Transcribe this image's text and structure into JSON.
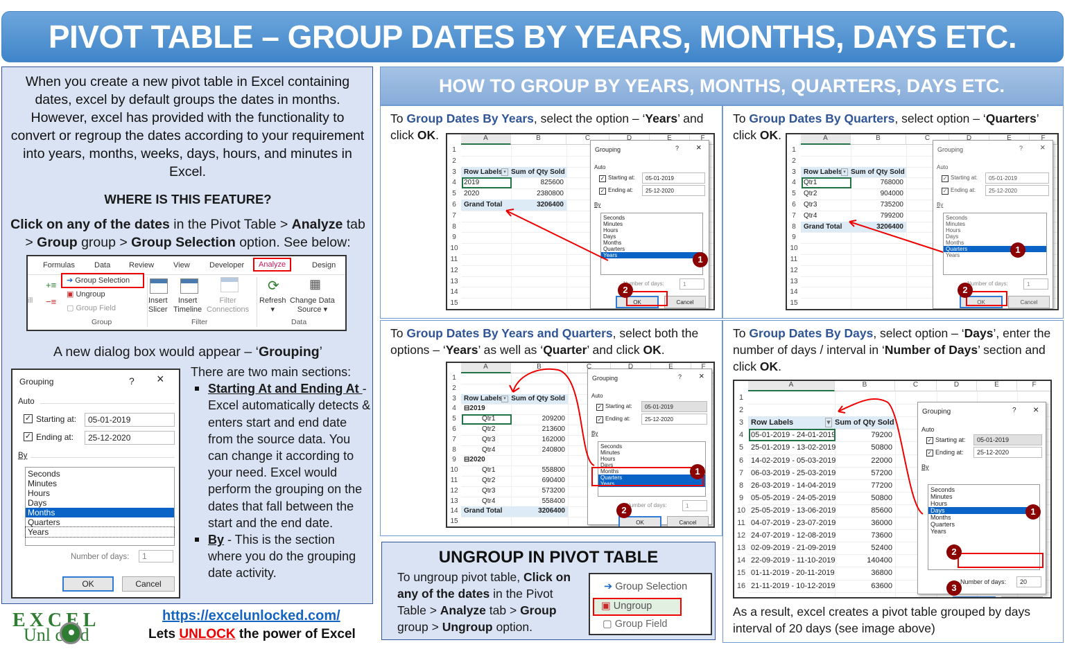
{
  "banner_title": "PIVOT TABLE – GROUP DATES BY YEARS, MONTHS, DAYS ETC.",
  "left": {
    "intro": "When you create a new pivot table in Excel containing dates, excel by default groups the dates in months. However, excel has provided with the functionality to convert or regroup the dates according to your requirement into years, months, weeks, days, hours, and minutes in Excel.",
    "where_heading": "WHERE IS THIS FEATURE?",
    "click_text": {
      "b1": "Click on any of the dates",
      "t1": " in the Pivot Table > ",
      "b2": "Analyze",
      "t2": " tab > ",
      "b3": "Group",
      "t3": " group > ",
      "b4": "Group Selection",
      "t4": " option. See below:"
    },
    "ribbon": {
      "tabs": [
        "Formulas",
        "Data",
        "Review",
        "View",
        "Developer",
        "Analyze",
        "Design"
      ],
      "active_tab": "Analyze",
      "group_items": [
        "Group Selection",
        "Ungroup",
        "Group Field"
      ],
      "filter_items": [
        "Insert Slicer",
        "Insert Timeline",
        "Filter Connections"
      ],
      "data_items": [
        "Refresh",
        "Change Data Source"
      ],
      "group_labels": [
        "Group",
        "Filter",
        "Data"
      ],
      "partial_left": "ill"
    },
    "new_dialog_text_pre": "A new dialog box would appear – ‘",
    "new_dialog_text_b": "Grouping",
    "new_dialog_text_post": "’",
    "sections_intro": "There are two main sections:",
    "bullet1_title": "Starting At and Ending At ",
    "bullet1_text": "- Excel automatically detects & enters start and end date from the source data. You can change it according to your need. Excel would perform the grouping on the dates that fall between the start and the end date.",
    "bullet2_title": "By",
    "bullet2_text": " - This is the section where you do the grouping date activity."
  },
  "dialog": {
    "title": "Grouping",
    "help": "?",
    "close": "×",
    "auto_label": "Auto",
    "starting_label": "Starting at:",
    "ending_label": "Ending at:",
    "starting_value": "05-01-2019",
    "ending_value": "25-12-2020",
    "by_label": "By",
    "options": [
      "Seconds",
      "Minutes",
      "Hours",
      "Days",
      "Months",
      "Quarters",
      "Years"
    ],
    "number_of_days_label": "Number of days:",
    "ok": "OK",
    "cancel": "Cancel"
  },
  "main_dialog": {
    "selected": "Months",
    "number_of_days": "1"
  },
  "footer": {
    "logo_top": "EXCEL",
    "logo_bottom": "Unl  cked",
    "link": "https://excelunlocked.com/",
    "tagline_pre": "Lets ",
    "tagline_em": "UNLOCK",
    "tagline_post": " the power of Excel"
  },
  "right_heading": "HOW TO GROUP BY YEARS, MONTHS, QUARTERS, DAYS ETC.",
  "sheet_common": {
    "columns": [
      "A",
      "B",
      "C",
      "D",
      "E",
      "F"
    ],
    "row_labels_header": "Row Labels",
    "value_header": "Sum of Qty Sold",
    "grand_total": "Grand Total"
  },
  "cards": {
    "years": {
      "pre": "To ",
      "blue": "Group Dates By Years",
      "mid": ", select the option – ‘",
      "b1": "Years",
      "post": "’ and click ",
      "b2": "OK",
      "end": ".",
      "rows": [
        [
          "2019",
          "825600"
        ],
        [
          "2020",
          "2380800"
        ]
      ],
      "grand_total": "3206400",
      "selected": [
        "Years"
      ],
      "number_of_days": "1",
      "badges": [
        "1",
        "2"
      ]
    },
    "quarters": {
      "pre": "To ",
      "blue": "Group Dates By Quarters",
      "mid": ", select option – ‘",
      "b1": "Quarters",
      "post": "’ click ",
      "b2": "OK",
      "end": ".",
      "rows": [
        [
          "Qtr1",
          "768000"
        ],
        [
          "Qtr2",
          "904000"
        ],
        [
          "Qtr3",
          "735200"
        ],
        [
          "Qtr4",
          "799200"
        ]
      ],
      "grand_total": "3206400",
      "selected": [
        "Quarters"
      ],
      "number_of_days": "1",
      "badges": [
        "1",
        "2"
      ]
    },
    "years_quarters": {
      "pre": "To ",
      "blue": "Group Dates By Years and Quarters",
      "mid": ", select both the options – ‘",
      "b1": "Years",
      "mid2": "’ as well as ‘",
      "b2": "Quarter",
      "post": "’ and click ",
      "b3": "OK",
      "end": ".",
      "groups": [
        {
          "year": "2019",
          "rows": [
            [
              "Qtr1",
              "209200"
            ],
            [
              "Qtr2",
              "213600"
            ],
            [
              "Qtr3",
              "162000"
            ],
            [
              "Qtr4",
              "240800"
            ]
          ]
        },
        {
          "year": "2020",
          "rows": [
            [
              "Qtr1",
              "558800"
            ],
            [
              "Qtr2",
              "690400"
            ],
            [
              "Qtr3",
              "573200"
            ],
            [
              "Qtr4",
              "558400"
            ]
          ]
        }
      ],
      "grand_total": "3206400",
      "selected": [
        "Quarters",
        "Years"
      ],
      "number_of_days": "1",
      "badges": [
        "1",
        "2"
      ]
    },
    "days": {
      "pre": "To ",
      "blue": "Group Dates By Days",
      "mid": ", select option – ‘",
      "b1": "Days",
      "mid2": "’, enter the number of days / interval  in ‘",
      "b2": "Number of Days",
      "post": "’ section and click ",
      "b3": "OK",
      "end": ".",
      "rows": [
        [
          "05-01-2019 - 24-01-2019",
          "79200"
        ],
        [
          "25-01-2019 - 13-02-2019",
          "50800"
        ],
        [
          "14-02-2019 - 05-03-2019",
          "22000"
        ],
        [
          "06-03-2019 - 25-03-2019",
          "57200"
        ],
        [
          "26-03-2019 - 14-04-2019",
          "77200"
        ],
        [
          "05-05-2019 - 24-05-2019",
          "50800"
        ],
        [
          "25-05-2019 - 13-06-2019",
          "85600"
        ],
        [
          "04-07-2019 - 23-07-2019",
          "36000"
        ],
        [
          "24-07-2019 - 12-08-2019",
          "73600"
        ],
        [
          "02-09-2019 - 21-09-2019",
          "52400"
        ],
        [
          "22-09-2019 - 11-10-2019",
          "140400"
        ],
        [
          "01-11-2019 - 20-11-2019",
          "36800"
        ],
        [
          "21-11-2019 - 10-12-2019",
          "63600"
        ]
      ],
      "selected": [
        "Days"
      ],
      "number_of_days": "20",
      "badges": [
        "1",
        "2",
        "3"
      ],
      "result_text": "As a result, excel creates a pivot table grouped by days interval of 20 days (see image above)"
    }
  },
  "ungroup": {
    "heading": "UNGROUP IN PIVOT TABLE",
    "t1": "To ungroup pivot table, ",
    "b1": "Click on any of the dates",
    "t2": " in the Pivot Table > ",
    "b2": "Analyze",
    "t3": " tab > ",
    "b3": "Group",
    "t4": " group > ",
    "b4": "Ungroup",
    "t5": " option.",
    "items": [
      "Group Selection",
      "Ungroup",
      "Group Field"
    ]
  },
  "colors": {
    "banner": "#4a8fd3",
    "panel_bg": "#dae3f3",
    "accent_blue": "#2f5597",
    "selection": "#0a64c8",
    "highlight_red": "#ee0000",
    "badge": "#8b0000"
  }
}
